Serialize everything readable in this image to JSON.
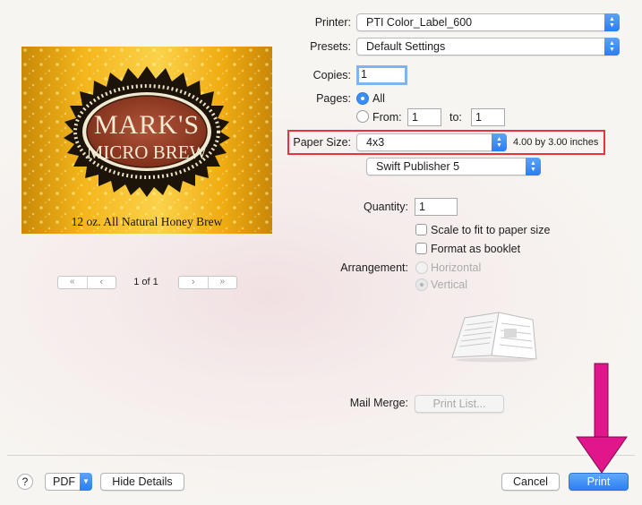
{
  "printer": {
    "label": "Printer:",
    "value": "PTI Color_Label_600"
  },
  "presets": {
    "label": "Presets:",
    "value": "Default Settings"
  },
  "copies": {
    "label": "Copies:",
    "value": "1"
  },
  "pages": {
    "label": "Pages:",
    "all_label": "All",
    "from_label": "From:",
    "from_value": "1",
    "to_label": "to:",
    "to_value": "1"
  },
  "paper_size": {
    "label": "Paper Size:",
    "value": "4x3",
    "dimensions": "4.00 by 3.00 inches"
  },
  "app_panel": {
    "value": "Swift Publisher 5"
  },
  "quantity": {
    "label": "Quantity:",
    "value": "1"
  },
  "options": {
    "scale_label": "Scale to fit to paper size",
    "booklet_label": "Format as booklet"
  },
  "arrangement": {
    "label": "Arrangement:",
    "horizontal": "Horizontal",
    "vertical": "Vertical"
  },
  "mail_merge": {
    "label": "Mail Merge:",
    "button": "Print List..."
  },
  "preview": {
    "title_line1": "MARK'S",
    "title_line2": "MICRO BREW",
    "tagline": "12 oz. All Natural Honey Brew",
    "page_indicator": "1 of 1",
    "first_glyph": "«",
    "prev_glyph": "‹",
    "next_glyph": "›",
    "last_glyph": "»"
  },
  "footer": {
    "help": "?",
    "pdf": "PDF",
    "hide_details": "Hide Details",
    "cancel": "Cancel",
    "print": "Print"
  },
  "colors": {
    "accent": "#2d7ff2",
    "highlight_box": "#e8323c",
    "annotation_arrow": "#e0168a",
    "label_gold": "#f2b21a",
    "label_oval": "#8e3a22"
  }
}
